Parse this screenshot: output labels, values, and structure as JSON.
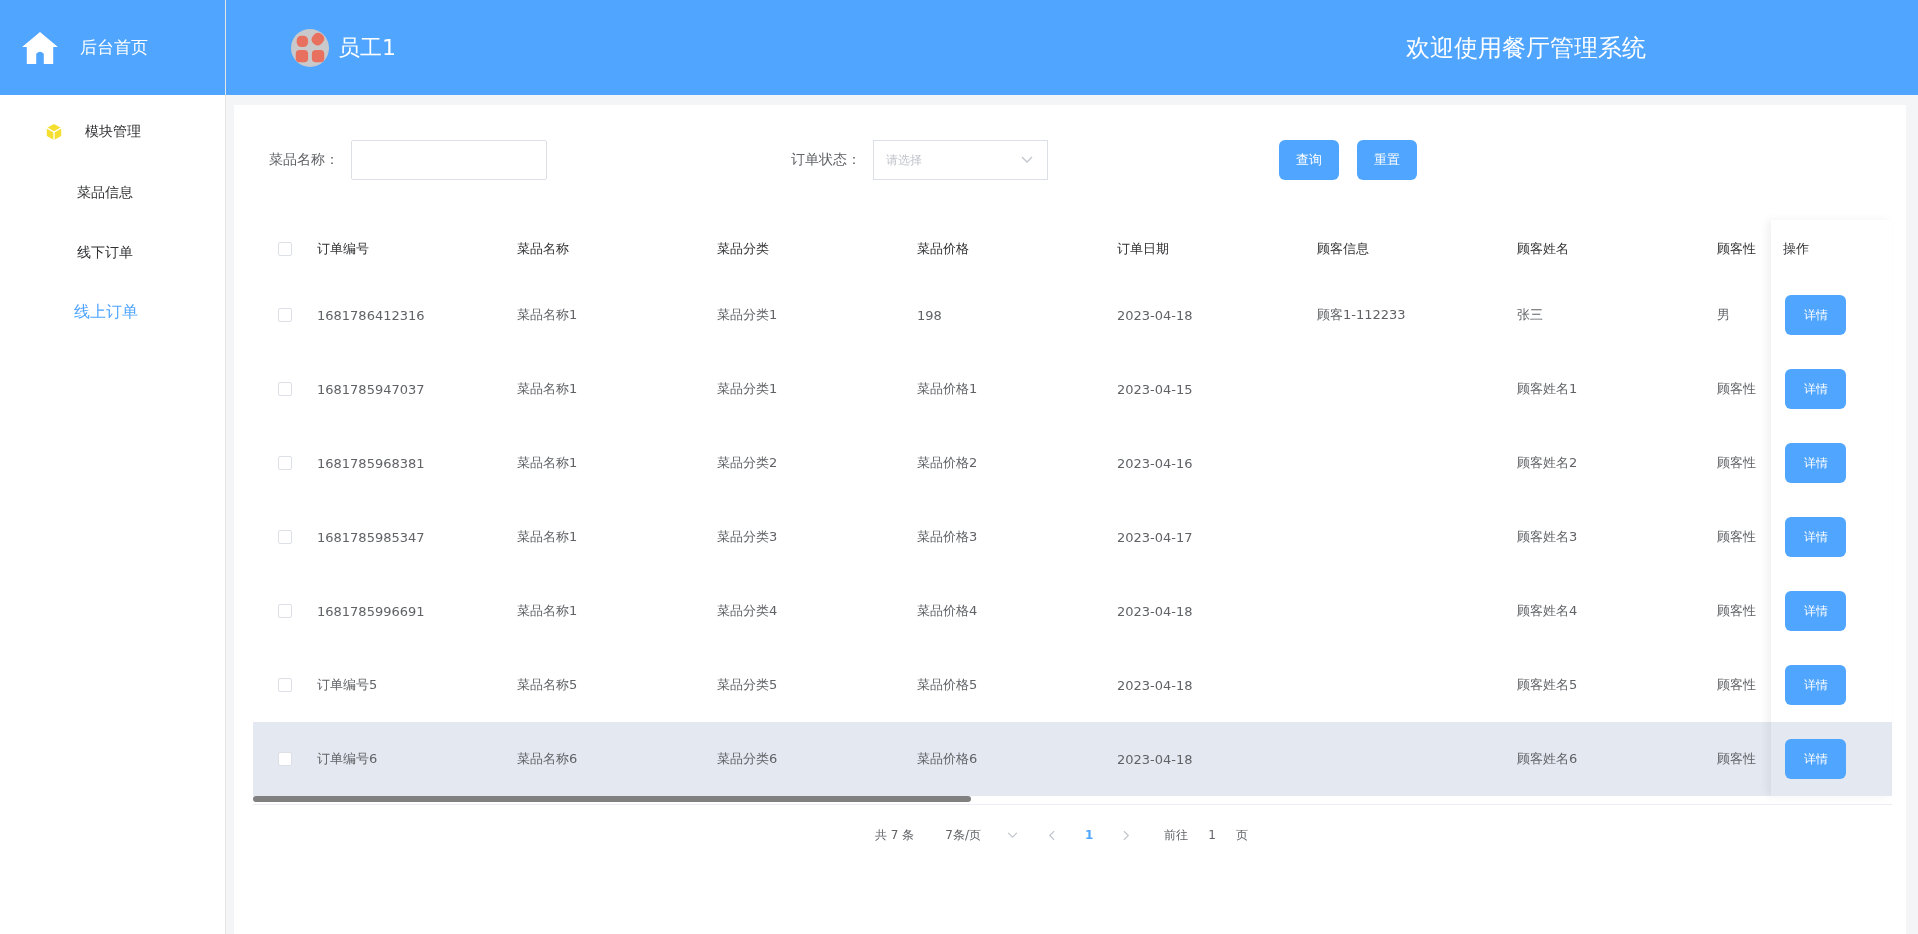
{
  "sidebar": {
    "home": {
      "label": "后台首页"
    },
    "menu": {
      "label": "模块管理",
      "items": [
        {
          "label": "菜品信息",
          "selected": false
        },
        {
          "label": "线下订单",
          "selected": false
        },
        {
          "label": "线上订单",
          "selected": true
        }
      ]
    }
  },
  "header": {
    "user": "员工1",
    "title": "欢迎使用餐厅管理系统"
  },
  "filters": [
    {
      "kind": "text",
      "label": "菜品名称："
    },
    {
      "kind": "select",
      "label": "订单状态：",
      "placeholder": "请选择"
    }
  ],
  "buttons": [
    "查询",
    "重置"
  ],
  "table": {
    "select_all_checked": false,
    "columns": [
      "订单编号",
      "菜品名称",
      "菜品分类",
      "菜品价格",
      "订单日期",
      "顾客信息",
      "顾客姓名",
      "顾客性"
    ],
    "action_column": "操作",
    "rows": [
      {
        "checked": false,
        "highlighted": false,
        "cells": [
          "1681786412316",
          "菜品名称1",
          "菜品分类1",
          "198",
          "2023-04-18",
          "顾客1-112233",
          "张三",
          "男"
        ],
        "action": "详情"
      },
      {
        "checked": false,
        "highlighted": false,
        "cells": [
          "1681785947037",
          "菜品名称1",
          "菜品分类1",
          "菜品价格1",
          "2023-04-15",
          null,
          "顾客姓名1",
          "顾客性"
        ],
        "action": "详情"
      },
      {
        "checked": false,
        "highlighted": false,
        "cells": [
          "1681785968381",
          "菜品名称1",
          "菜品分类2",
          "菜品价格2",
          "2023-04-16",
          null,
          "顾客姓名2",
          "顾客性"
        ],
        "action": "详情"
      },
      {
        "checked": false,
        "highlighted": false,
        "cells": [
          "1681785985347",
          "菜品名称1",
          "菜品分类3",
          "菜品价格3",
          "2023-04-17",
          null,
          "顾客姓名3",
          "顾客性"
        ],
        "action": "详情"
      },
      {
        "checked": false,
        "highlighted": false,
        "cells": [
          "1681785996691",
          "菜品名称1",
          "菜品分类4",
          "菜品价格4",
          "2023-04-18",
          null,
          "顾客姓名4",
          "顾客性"
        ],
        "action": "详情"
      },
      {
        "checked": false,
        "highlighted": false,
        "cells": [
          "订单编号5",
          "菜品名称5",
          "菜品分类5",
          "菜品价格5",
          "2023-04-18",
          null,
          "顾客姓名5",
          "顾客性"
        ],
        "action": "详情"
      },
      {
        "checked": false,
        "highlighted": true,
        "cells": [
          "订单编号6",
          "菜品名称6",
          "菜品分类6",
          "菜品价格6",
          "2023-04-18",
          null,
          "顾客姓名6",
          "顾客性"
        ],
        "action": "详情"
      }
    ]
  },
  "pagination": {
    "total": "共 7 条",
    "page_size": "7条/页",
    "pages": [
      {
        "label": "1",
        "selected": true
      }
    ],
    "jump_label": "前往",
    "jump_value": "1",
    "jump_suffix": "页"
  }
}
